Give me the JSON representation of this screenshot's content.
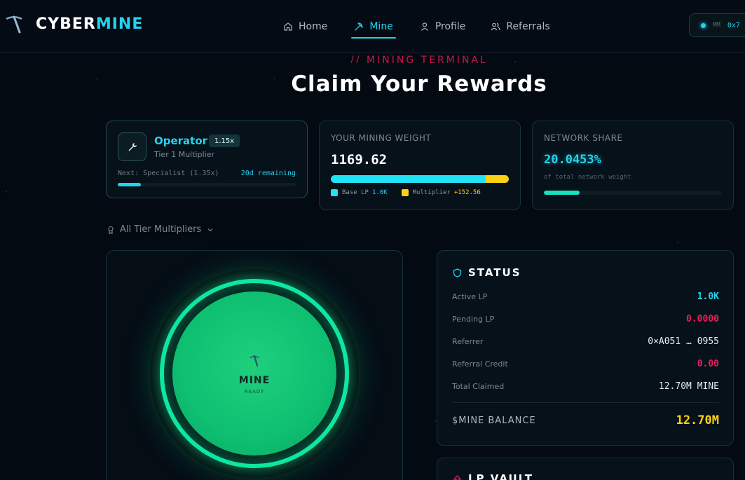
{
  "brand": {
    "part1": "CYBER",
    "part2": "MINE"
  },
  "nav": [
    {
      "label": "Home",
      "icon": "home-icon"
    },
    {
      "label": "Mine",
      "icon": "pickaxe-icon",
      "active": true
    },
    {
      "label": "Profile",
      "icon": "user-icon"
    },
    {
      "label": "Referrals",
      "icon": "users-icon"
    }
  ],
  "wallet": {
    "provider": "MM",
    "address": "0x7"
  },
  "hero": {
    "eyebrow": "// MINING TERMINAL",
    "title": "Claim Your Rewards"
  },
  "tier": {
    "icon": "wrench-icon",
    "name": "Operator",
    "multiplier": "1.15x",
    "subtitle": "Tier 1 Multiplier",
    "next": "Next: Specialist (1.35x)",
    "remaining": "20d remaining",
    "progress": 0.13
  },
  "weight": {
    "label": "YOUR MINING WEIGHT",
    "value": "1169.62",
    "base_fraction": 0.87,
    "base_label": "Base LP",
    "base_value": "1.0K",
    "mult_label": "Multiplier",
    "mult_value": "+152.56"
  },
  "share": {
    "label": "NETWORK SHARE",
    "value": "20.0453%",
    "subtitle": "of total network weight",
    "fraction": 0.2
  },
  "tiers_toggle": {
    "label": "All Tier Multipliers",
    "icon": "award-icon"
  },
  "mine_button": {
    "label": "MINE",
    "status": "READY",
    "icon": "pickaxe-icon"
  },
  "status": {
    "title": "STATUS",
    "rows": [
      {
        "key": "Active LP",
        "value": "1.0K",
        "color": "cyan"
      },
      {
        "key": "Pending LP",
        "value": "0.0000",
        "color": "pink"
      },
      {
        "key": "Referrer",
        "value": "0×A051 … 0955",
        "color": "white"
      },
      {
        "key": "Referral Credit",
        "value": "0.00",
        "color": "pink"
      },
      {
        "key": "Total Claimed",
        "value": "12.70M MINE",
        "color": "white"
      }
    ],
    "balance_label": "$MINE BALANCE",
    "balance_value": "12.70M"
  },
  "vault": {
    "title": "LP VAULT"
  },
  "colors": {
    "accent": "#22d3ee",
    "gold": "#fcd114",
    "pink": "#ec1c5a",
    "green": "#0ee79f",
    "bg": "#040a12"
  }
}
